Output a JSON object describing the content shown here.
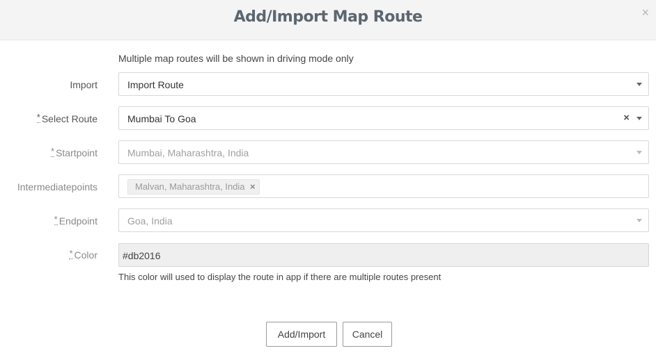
{
  "modal": {
    "title": "Add/Import Map Route",
    "close_symbol": "×"
  },
  "help_top": "Multiple map routes will be shown in driving mode only",
  "required_marker": "*",
  "form": {
    "import": {
      "label": "Import",
      "value": "Import Route"
    },
    "select_route": {
      "label": "Select Route",
      "value": "Mumbai To Goa",
      "clear_symbol": "×"
    },
    "startpoint": {
      "label": "Startpoint",
      "value": "Mumbai, Maharashtra, India"
    },
    "intermediatepoints": {
      "label": "Intermediatepoints",
      "tags": [
        "Malvan, Maharashtra, India"
      ],
      "tag_remove_symbol": "×"
    },
    "endpoint": {
      "label": "Endpoint",
      "value": "Goa, India"
    },
    "color": {
      "label": "Color",
      "value": "#db2016",
      "help": "This color will used to display the route in app if there are multiple routes present"
    }
  },
  "buttons": {
    "submit": "Add/Import",
    "cancel": "Cancel"
  },
  "colors": {
    "header_bg": "#f4f4f4",
    "title": "#5b6670",
    "disabled_text": "#a0a0a0"
  },
  "icons": {
    "close": "close-icon",
    "dropdown": "chevron-down-icon",
    "clear": "clear-icon",
    "tag_remove": "remove-tag-icon"
  }
}
